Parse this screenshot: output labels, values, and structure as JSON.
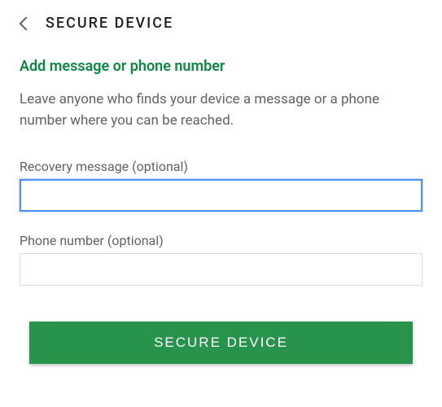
{
  "header": {
    "title": "SECURE DEVICE"
  },
  "main": {
    "subtitle": "Add message or phone number",
    "description": "Leave anyone who finds your device a message or a phone number where you can be reached.",
    "recovery_label": "Recovery message (optional)",
    "recovery_value": "",
    "phone_label": "Phone number (optional)",
    "phone_value": "",
    "submit_label": "SECURE DEVICE"
  },
  "colors": {
    "accent": "#0a8a3f",
    "button": "#28944b",
    "focus": "#4d90fe"
  }
}
